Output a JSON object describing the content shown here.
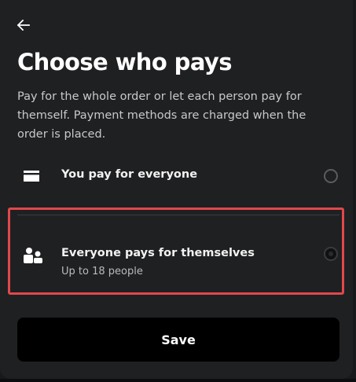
{
  "dialog": {
    "back_icon": "arrow-left-icon",
    "title": "Choose who pays",
    "description": "Pay for the whole order or let each person pay for themself. Payment methods are charged when the order is placed."
  },
  "options": [
    {
      "icon": "card-icon",
      "label": "You pay for everyone",
      "selected": false
    },
    {
      "icon": "people-icon",
      "label": "Everyone pays for themselves",
      "sublabel": "Up to 18 people",
      "selected": true
    }
  ],
  "save_label": "Save",
  "colors": {
    "background": "#1f2022",
    "button": "#000000",
    "highlight": "#e0484b",
    "text_primary": "#ffffff",
    "text_secondary": "#c8c9cb"
  }
}
